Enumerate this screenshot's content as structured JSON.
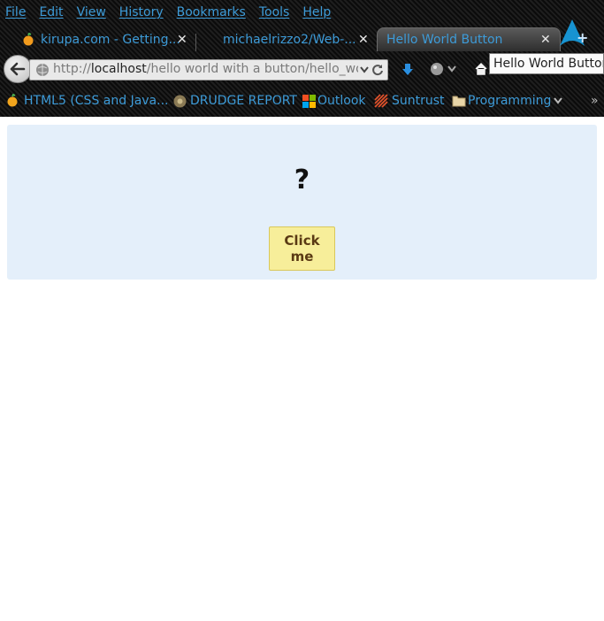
{
  "menu": [
    "File",
    "Edit",
    "View",
    "History",
    "Bookmarks",
    "Tools",
    "Help"
  ],
  "tabs": [
    {
      "title": "kirupa.com - Getting...",
      "active": false
    },
    {
      "title": "michaelrizzo2/Web-...",
      "active": false
    },
    {
      "title": "Hello World Button",
      "active": true
    }
  ],
  "url": {
    "scheme": "http://",
    "host": "localhost",
    "path": "/hello world with a button/hello_wor"
  },
  "tooltip": "Hello World Button",
  "bookmarks": [
    {
      "label": "HTML5 (CSS and Java...",
      "icon": "fruit-icon"
    },
    {
      "label": "DRUDGE REPORT",
      "icon": "globe-icon"
    },
    {
      "label": "Outlook",
      "icon": "windows-logo-icon"
    },
    {
      "label": "Suntrust",
      "icon": "sunburst-icon"
    },
    {
      "label": "Programming",
      "icon": "folder-icon"
    }
  ],
  "content": {
    "heading": "?",
    "button_label": "Click me"
  },
  "colors": {
    "link_blue": "#3d9bd8",
    "panel_bg": "#e4effa",
    "button_bg": "#f7ee9a",
    "button_text": "#5a3a14"
  }
}
